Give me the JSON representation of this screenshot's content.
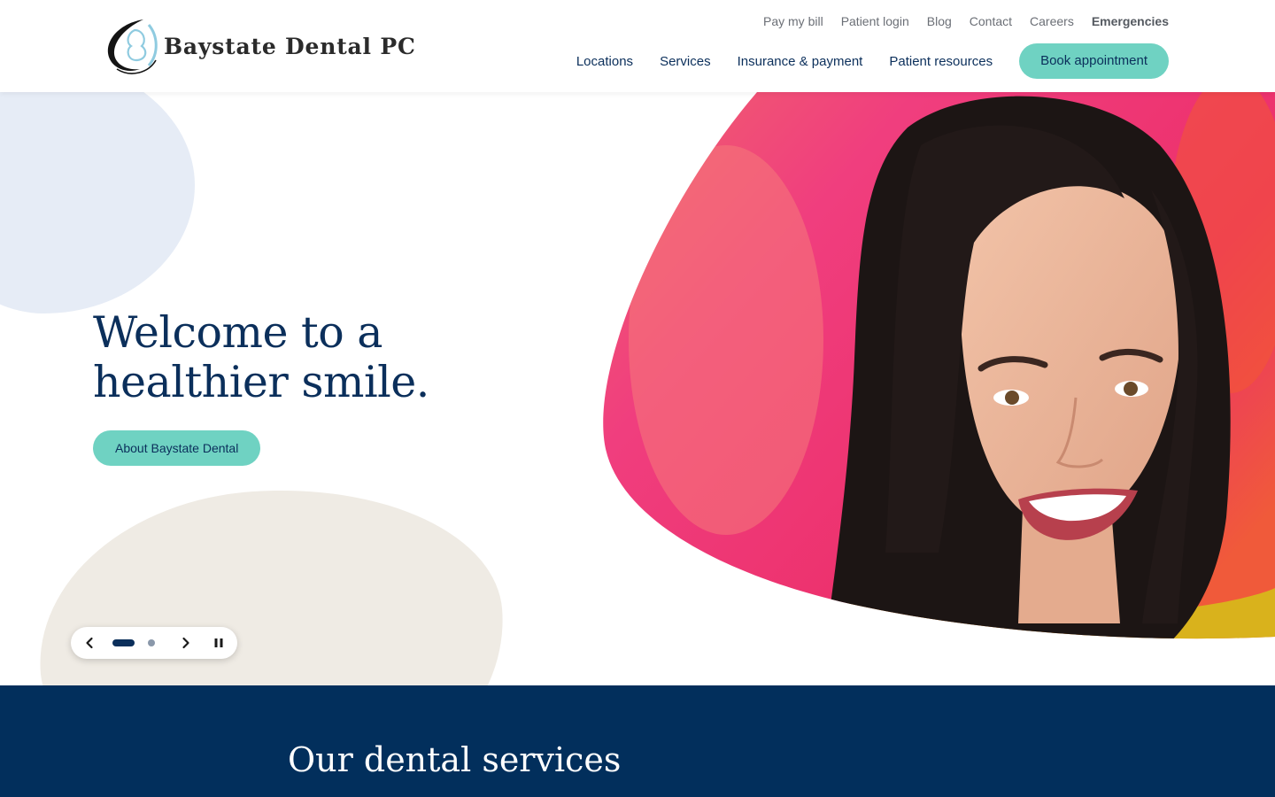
{
  "brand": {
    "name": "Baystate Dental PC"
  },
  "utility_nav": [
    {
      "label": "Pay my bill"
    },
    {
      "label": "Patient login"
    },
    {
      "label": "Blog"
    },
    {
      "label": "Contact"
    },
    {
      "label": "Careers"
    },
    {
      "label": "Emergencies"
    }
  ],
  "main_nav": [
    {
      "label": "Locations"
    },
    {
      "label": "Services"
    },
    {
      "label": "Insurance & payment"
    },
    {
      "label": "Patient resources"
    }
  ],
  "cta": {
    "book_label": "Book appointment"
  },
  "hero": {
    "title": "Welcome to a healthier smile.",
    "button_label": "About Baystate Dental",
    "carousel": {
      "slide_count": 2,
      "active_slide": 1
    }
  },
  "services": {
    "title": "Our dental services"
  },
  "colors": {
    "navy": "#0b2f5b",
    "teal": "#6fd2c2",
    "services_bg": "#022f5c",
    "blob_blue": "#e6ecf6",
    "blob_beige": "#efebe4"
  }
}
